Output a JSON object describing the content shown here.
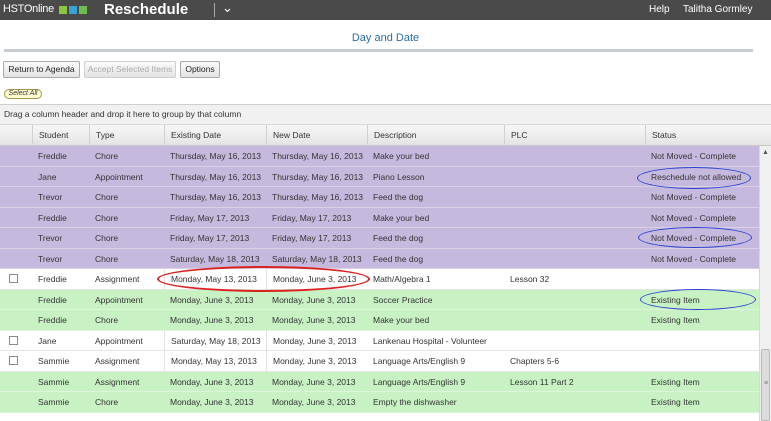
{
  "topbar": {
    "logo_text": "HSTOnline",
    "app_title": "Reschedule",
    "app_chevron": "⌄",
    "help": "Help",
    "user": "Talitha Gormley",
    "bg_color": "#4a4a4a"
  },
  "page": {
    "heading": "Day and Date"
  },
  "toolbar": {
    "return_label": "Return to Agenda",
    "accept_label": "Accept Selected Items",
    "options_label": "Options"
  },
  "select_all": "Select All",
  "grid": {
    "group_hint": "Drag a column header and drop it here to group by that column",
    "columns": [
      "Student",
      "Type",
      "Existing Date",
      "New Date",
      "Description",
      "PLC",
      "Status"
    ],
    "rows": [
      {
        "style": "purple",
        "checkbox": false,
        "student": "Freddie",
        "type": "Chore",
        "existing": "Thursday, May 16, 2013",
        "new": "Thursday, May 16, 2013",
        "description": "Make your bed",
        "plc": "",
        "status": "Not Moved - Complete"
      },
      {
        "style": "purple",
        "checkbox": false,
        "student": "Jane",
        "type": "Appointment",
        "existing": "Thursday, May 16, 2013",
        "new": "Thursday, May 16, 2013",
        "description": "Piano Lesson",
        "plc": "",
        "status": "Reschedule not allowed"
      },
      {
        "style": "purple",
        "checkbox": false,
        "student": "Trevor",
        "type": "Chore",
        "existing": "Thursday, May 16, 2013",
        "new": "Thursday, May 16, 2013",
        "description": "Feed the dog",
        "plc": "",
        "status": "Not Moved - Complete"
      },
      {
        "style": "purple",
        "checkbox": false,
        "student": "Freddie",
        "type": "Chore",
        "existing": "Friday, May 17, 2013",
        "new": "Friday, May 17, 2013",
        "description": "Make your bed",
        "plc": "",
        "status": "Not Moved - Complete"
      },
      {
        "style": "purple",
        "checkbox": false,
        "student": "Trevor",
        "type": "Chore",
        "existing": "Friday, May 17, 2013",
        "new": "Friday, May 17, 2013",
        "description": "Feed the dog",
        "plc": "",
        "status": "Not Moved - Complete"
      },
      {
        "style": "purple",
        "checkbox": false,
        "student": "Trevor",
        "type": "Chore",
        "existing": "Saturday, May 18, 2013",
        "new": "Saturday, May 18, 2013",
        "description": "Feed the dog",
        "plc": "",
        "status": "Not Moved - Complete"
      },
      {
        "style": "white",
        "checkbox": true,
        "student": "Freddie",
        "type": "Assignment",
        "existing": "Monday, May 13, 2013",
        "new": "Monday, June 3, 2013",
        "description": "Math/Algebra 1",
        "plc": "Lesson 32",
        "status": ""
      },
      {
        "style": "green",
        "checkbox": false,
        "student": "Freddie",
        "type": "Appointment",
        "existing": "Monday, June 3, 2013",
        "new": "Monday, June 3, 2013",
        "description": "Soccer Practice",
        "plc": "",
        "status": "Existing Item"
      },
      {
        "style": "green",
        "checkbox": false,
        "student": "Freddie",
        "type": "Chore",
        "existing": "Monday, June 3, 2013",
        "new": "Monday, June 3, 2013",
        "description": "Make your bed",
        "plc": "",
        "status": "Existing Item"
      },
      {
        "style": "white",
        "checkbox": true,
        "student": "Jane",
        "type": "Appointment",
        "existing": "Saturday, May 18, 2013",
        "new": "Monday, June 3, 2013",
        "description": "Lankenau Hospital - Volunteer",
        "plc": "",
        "status": ""
      },
      {
        "style": "white",
        "checkbox": true,
        "student": "Sammie",
        "type": "Assignment",
        "existing": "Monday, May 13, 2013",
        "new": "Monday, June 3, 2013",
        "description": "Language Arts/English 9",
        "plc": "Chapters 5-6",
        "status": ""
      },
      {
        "style": "green",
        "checkbox": false,
        "student": "Sammie",
        "type": "Assignment",
        "existing": "Monday, June 3, 2013",
        "new": "Monday, June 3, 2013",
        "description": "Language Arts/English 9",
        "plc": "Lesson 11 Part 2",
        "status": "Existing Item"
      },
      {
        "style": "green",
        "checkbox": false,
        "student": "Sammie",
        "type": "Chore",
        "existing": "Monday, June 3, 2013",
        "new": "Monday, June 3, 2013",
        "description": "Empty the dishwasher",
        "plc": "",
        "status": "Existing Item"
      }
    ]
  },
  "colors": {
    "purple_row": "#c6b9de",
    "green_row": "#c8f2c4",
    "heading_blue": "#2b6ea8",
    "annotation_red": "#d9231f",
    "annotation_blue": "#2a3fd0"
  },
  "icons": {
    "scroll_up": "scroll-up-arrow-icon",
    "scroll_grip": "scroll-grip-icon"
  }
}
